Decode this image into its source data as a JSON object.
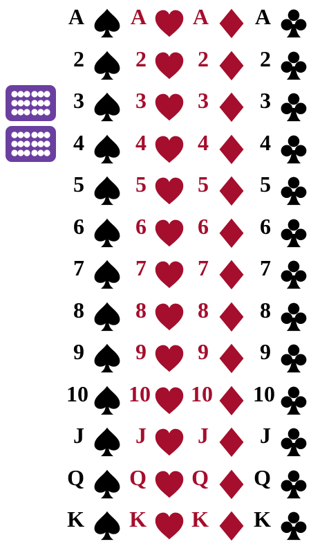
{
  "colors": {
    "black_suit": "#000000",
    "red_suit": "#a50e2d",
    "deck_back": "#6b3fa0",
    "deck_dots": "#ffffff"
  },
  "suits": [
    {
      "name": "spades",
      "icon": "spade-icon",
      "color": "#000000"
    },
    {
      "name": "hearts",
      "icon": "heart-icon",
      "color": "#a50e2d"
    },
    {
      "name": "diamonds",
      "icon": "diamond-icon",
      "color": "#a50e2d"
    },
    {
      "name": "clubs",
      "icon": "club-icon",
      "color": "#000000"
    }
  ],
  "ranks": [
    "A",
    "2",
    "3",
    "4",
    "5",
    "6",
    "7",
    "8",
    "9",
    "10",
    "J",
    "Q",
    "K"
  ],
  "decks": [
    {
      "icon": "card-back-icon"
    },
    {
      "icon": "card-back-icon"
    }
  ]
}
